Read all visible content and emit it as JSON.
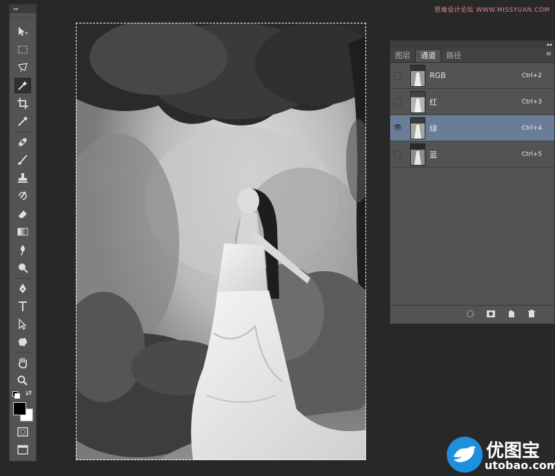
{
  "watermark": "思缘设计论坛 WWW.MISSYUAN.COM",
  "toolbar": {
    "header_glyph": "▸▸",
    "tools": [
      {
        "name": "move-tool",
        "icon": "move-icon"
      },
      {
        "name": "marquee-tool",
        "icon": "marquee-icon"
      },
      {
        "name": "lasso-tool",
        "icon": "lasso-icon"
      },
      {
        "name": "magic-wand-tool",
        "icon": "magic-wand-icon",
        "selected": true
      },
      {
        "name": "crop-tool",
        "icon": "crop-icon"
      },
      {
        "name": "eyedropper-tool",
        "icon": "eyedropper-icon"
      },
      {
        "name": "healing-brush-tool",
        "icon": "bandage-icon"
      },
      {
        "name": "brush-tool",
        "icon": "brush-icon"
      },
      {
        "name": "clone-stamp-tool",
        "icon": "stamp-icon"
      },
      {
        "name": "history-brush-tool",
        "icon": "history-brush-icon"
      },
      {
        "name": "eraser-tool",
        "icon": "eraser-icon"
      },
      {
        "name": "gradient-tool",
        "icon": "gradient-icon"
      },
      {
        "name": "blur-tool",
        "icon": "blur-icon"
      },
      {
        "name": "dodge-tool",
        "icon": "dodge-icon"
      },
      {
        "name": "pen-tool",
        "icon": "pen-icon"
      },
      {
        "name": "type-tool",
        "icon": "type-icon"
      },
      {
        "name": "path-selection-tool",
        "icon": "arrow-icon"
      },
      {
        "name": "shape-tool",
        "icon": "custom-shape-icon"
      },
      {
        "name": "hand-tool",
        "icon": "hand-icon"
      },
      {
        "name": "zoom-tool",
        "icon": "zoom-icon"
      }
    ],
    "foreground_color": "#000000",
    "background_color": "#ffffff"
  },
  "panel": {
    "collapse_glyph": "◂◂",
    "menu_glyph": "≡",
    "tabs": [
      {
        "label": "图层",
        "active": false
      },
      {
        "label": "通道",
        "active": true
      },
      {
        "label": "路径",
        "active": false
      }
    ],
    "channels": [
      {
        "name": "RGB",
        "shortcut": "Ctrl+2",
        "visible": false,
        "active": false
      },
      {
        "name": "红",
        "shortcut": "Ctrl+3",
        "visible": false,
        "active": false
      },
      {
        "name": "绿",
        "shortcut": "Ctrl+4",
        "visible": true,
        "active": true
      },
      {
        "name": "蓝",
        "shortcut": "Ctrl+5",
        "visible": false,
        "active": false
      }
    ],
    "eye_glyph": "👁"
  },
  "logo": {
    "brand": "优图宝",
    "domain": "utobao.com"
  },
  "colors": {
    "ui_bg": "#282828",
    "panel_bg": "#535353",
    "active_row": "#6a7d97",
    "logo_blue": "#1e8fdc"
  }
}
